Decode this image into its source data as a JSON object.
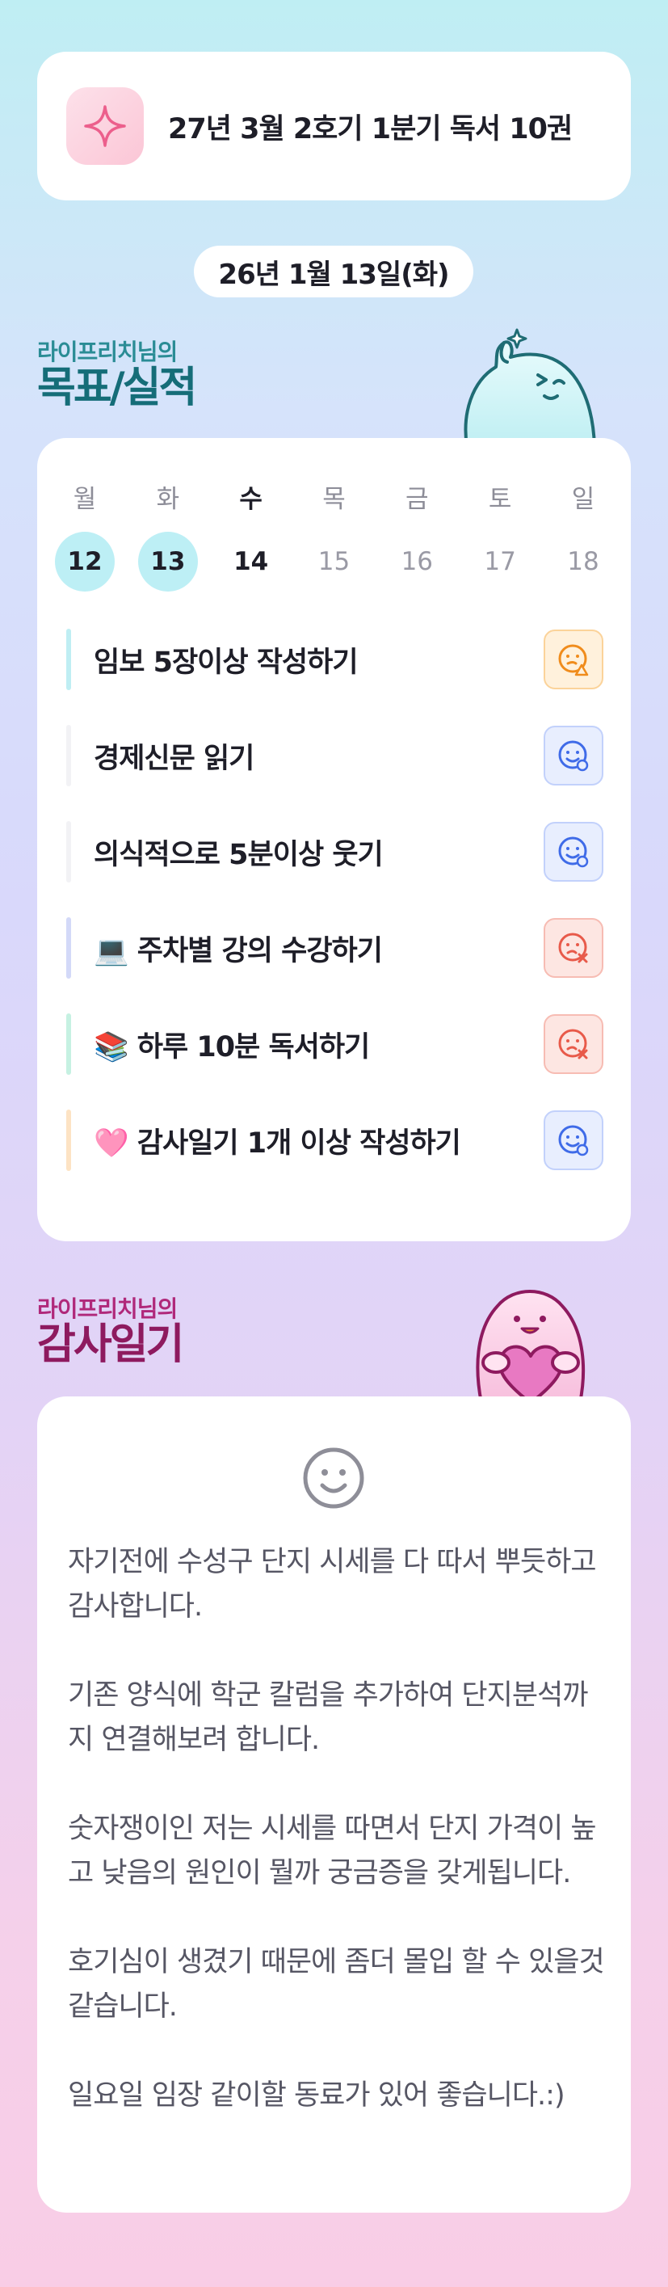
{
  "goal_banner": {
    "icon": "sparkle-icon",
    "text": "27년 3월 2호기 1분기 독서 10권"
  },
  "date_pill": "26년 1월 13일(화)",
  "goals_section": {
    "small": "라이프리치님의",
    "big": "목표/실적",
    "mascot": "green-ghost-mascot"
  },
  "week": [
    {
      "day": "월",
      "num": "12",
      "state": "done"
    },
    {
      "day": "화",
      "num": "13",
      "state": "done"
    },
    {
      "day": "수",
      "num": "14",
      "state": "today"
    },
    {
      "day": "목",
      "num": "15",
      "state": "future"
    },
    {
      "day": "금",
      "num": "16",
      "state": "future"
    },
    {
      "day": "토",
      "num": "17",
      "state": "future"
    },
    {
      "day": "일",
      "num": "18",
      "state": "future"
    }
  ],
  "goals": [
    {
      "label": "임보 5장이상 작성하기",
      "bar_color": "#bfeef3",
      "status": "warn",
      "status_icon": "face-warning-icon"
    },
    {
      "label": "경제신문 읽기",
      "bar_color": "#f2f2f5",
      "status": "ok",
      "status_icon": "face-check-icon"
    },
    {
      "label": "의식적으로 5분이상 웃기",
      "bar_color": "#f2f2f5",
      "status": "ok",
      "status_icon": "face-check-icon"
    },
    {
      "label": "💻 주차별 강의 수강하기",
      "bar_color": "#d3d9f8",
      "status": "fail",
      "status_icon": "face-x-icon"
    },
    {
      "label": "📚 하루 10분 독서하기",
      "bar_color": "#c6f1e2",
      "status": "fail",
      "status_icon": "face-x-icon"
    },
    {
      "label": "🩷 감사일기 1개 이상 작성하기",
      "bar_color": "#fde3c4",
      "status": "ok",
      "status_icon": "face-check-icon"
    }
  ],
  "status_colors": {
    "warn": "#f08c1c",
    "ok": "#3f6be8",
    "fail": "#e85a4a"
  },
  "gratitude_section": {
    "small": "라이프리치님의",
    "big": "감사일기",
    "mascot": "pink-heart-mascot"
  },
  "gratitude": {
    "icon": "smile-face-icon",
    "paragraphs": [
      "자기전에 수성구 단지 시세를 다 따서 뿌듯하고 감사합니다.",
      "기존 양식에 학군 칼럼을 추가하여 단지분석까지 연결해보려 합니다.",
      "숫자쟁이인 저는 시세를 따면서 단지 가격이 높고 낮음의 원인이 뭘까 궁금증을 갖게됩니다.",
      "호기심이 생겼기 때문에 좀더 몰입 할 수 있을것 같습니다.",
      "일요일 임장 같이할 동료가 있어 좋습니다.:)"
    ]
  }
}
